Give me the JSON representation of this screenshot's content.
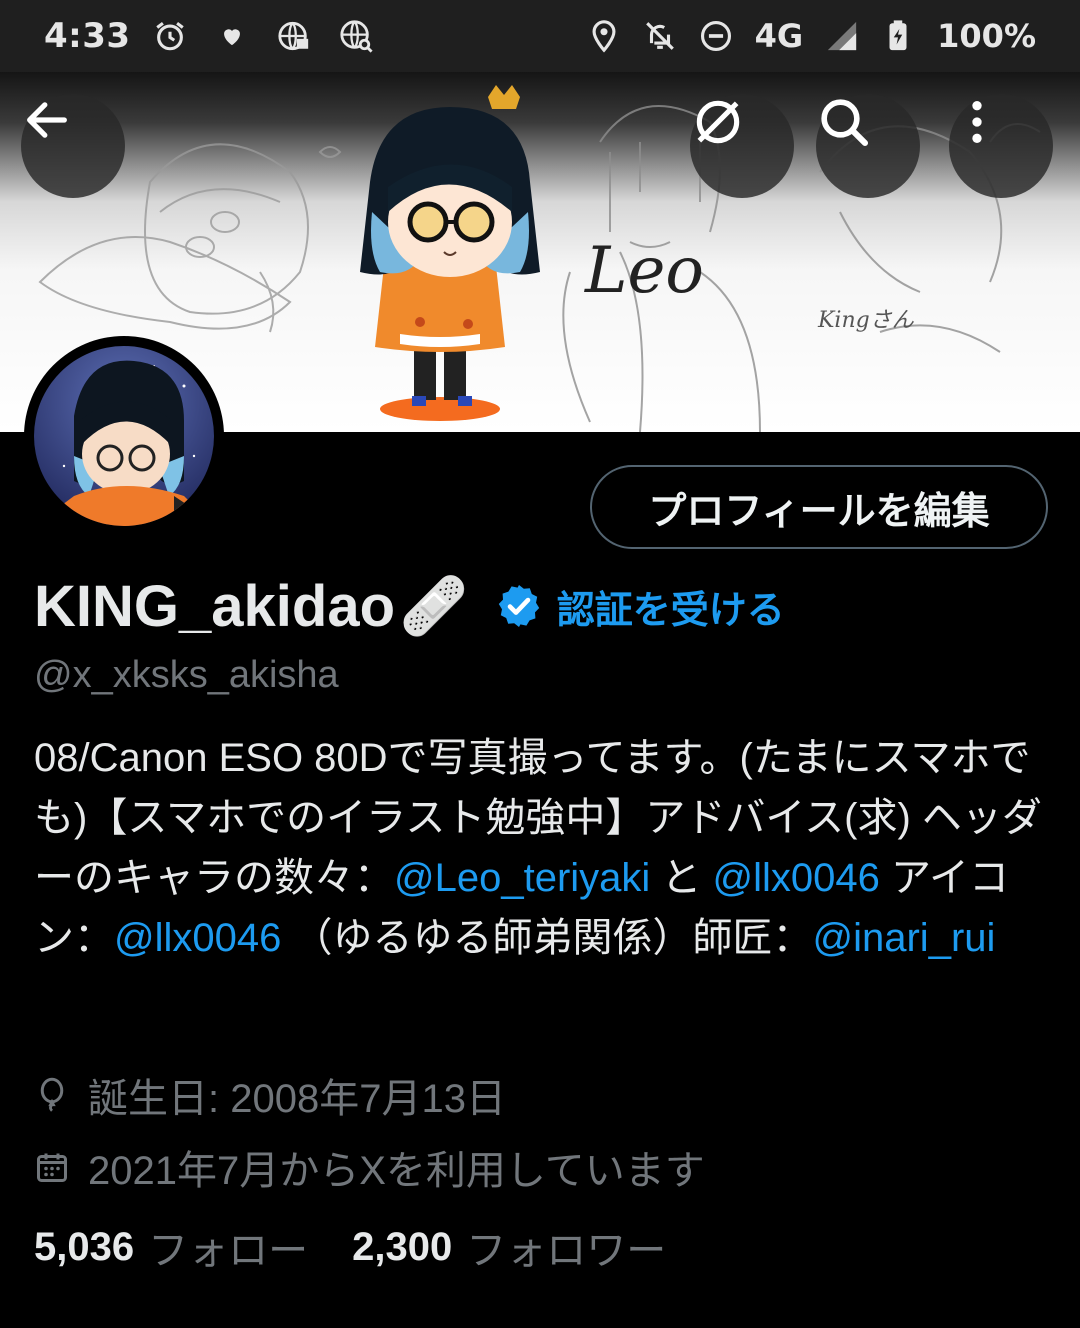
{
  "status_bar": {
    "time": "4:33",
    "network": "4G",
    "battery": "100%",
    "left_icons": [
      "alarm-icon",
      "heart-icon",
      "vpn-globe-icon",
      "globe-search-icon"
    ],
    "right_icons": [
      "location-icon",
      "notifications-off-icon",
      "do-not-disturb-icon",
      "signal-icon",
      "battery-icon"
    ]
  },
  "header": {
    "back_icon": "arrow-left-icon",
    "actions": [
      "no-circle-icon",
      "search-icon",
      "more-vertical-icon"
    ]
  },
  "banner": {
    "signature_text": "Leo",
    "small_signature_text": "Kingさん"
  },
  "profile": {
    "edit_button": "プロフィールを編集",
    "display_name": "KING_akidao",
    "name_emoji": "🩹",
    "verify_label": "認証を受ける",
    "handle": "@x_xksks_akisha",
    "bio": {
      "t1": "08/Canon ESO 80Dで写真撮ってます。(たまにスマホでも)【スマホでのイラスト勉強中】アドバイス(求) ヘッダーのキャラの数々：",
      "m1": "@Leo_teriyaki",
      "t2": " と ",
      "m2": "@llx0046",
      "t3": " アイコン：",
      "m3": "@llx0046",
      "t4": " （ゆるゆる師弟関係）師匠：",
      "m4": "@inari_rui"
    },
    "birthday": "誕生日: 2008年7月13日",
    "joined": "2021年7月からXを利用しています",
    "following_count": "5,036",
    "following_label": "フォロー",
    "followers_count": "2,300",
    "followers_label": "フォロワー"
  },
  "colors": {
    "background": "#000000",
    "accent": "#1d9bf0",
    "secondary_text": "#71767b",
    "primary_text": "#e7e9ea"
  }
}
